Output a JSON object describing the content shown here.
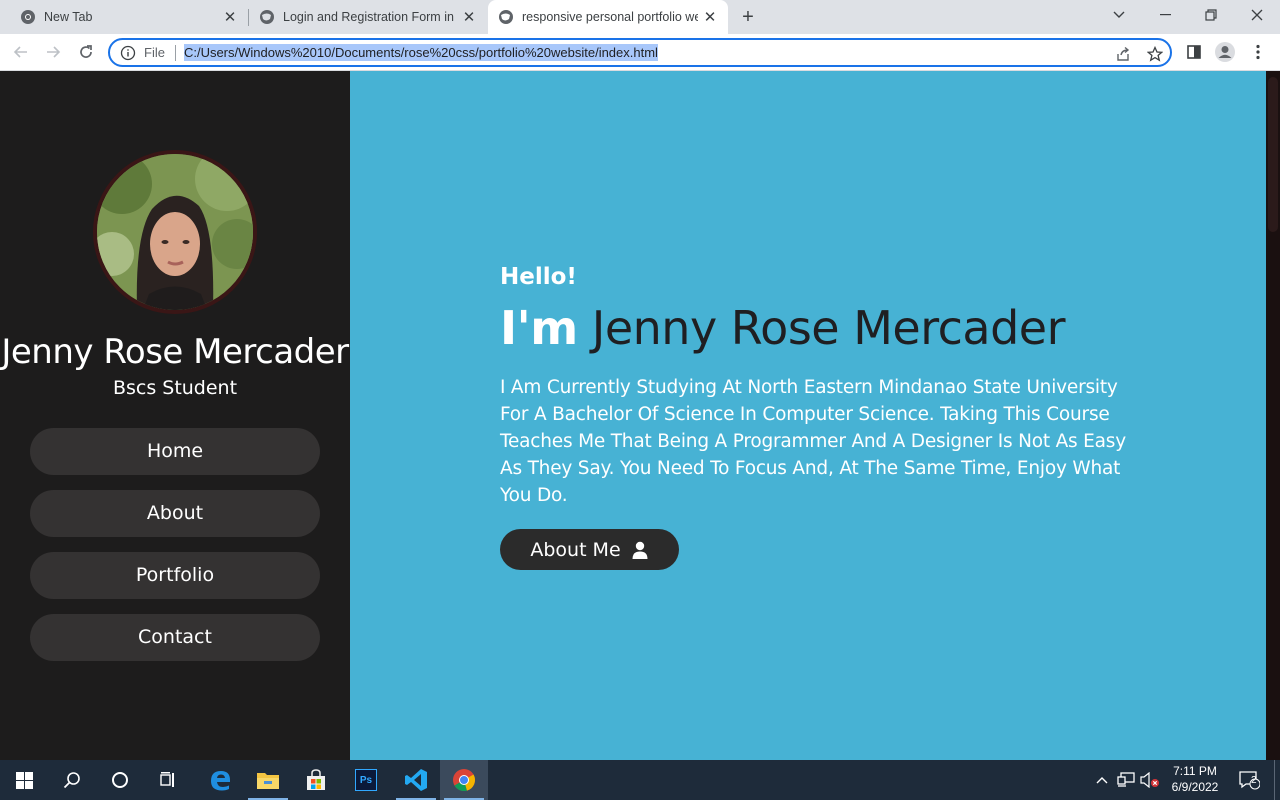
{
  "browser": {
    "tabs": [
      {
        "title": "New Tab",
        "active": false
      },
      {
        "title": "Login and Registration Form in H",
        "active": false
      },
      {
        "title": "responsive personal portfolio we",
        "active": true
      }
    ],
    "omnibox": {
      "scheme_label": "File",
      "url": "C:/Users/Windows%2010/Documents/rose%20css/portfolio%20website/index.html"
    },
    "icons": [
      "back-icon",
      "forward-icon",
      "reload-icon",
      "info-icon",
      "share-icon",
      "star-icon",
      "side-panel-icon",
      "profile-icon",
      "menu-icon"
    ]
  },
  "sidebar": {
    "name": "Jenny Rose Mercader",
    "role": "Bscs Student",
    "nav": [
      {
        "label": "Home"
      },
      {
        "label": "About"
      },
      {
        "label": "Portfolio"
      },
      {
        "label": "Contact"
      }
    ]
  },
  "hero": {
    "greeting": "Hello!",
    "im": "I'm",
    "name": "Jenny Rose Mercader",
    "bio": "I Am Currently Studying At North Eastern Mindanao State University For A Bachelor Of Science In Computer Science. Taking This Course Teaches Me That Being A Programmer And A Designer Is Not As Easy As They Say. You Need To Focus And, At The Same Time, Enjoy What You Do.",
    "button_label": "About Me"
  },
  "colors": {
    "sidebar_bg": "#1d1c1c",
    "main_bg": "#47b2d4",
    "nav_pill": "#343232",
    "button_bg": "#2b2b2b"
  },
  "taskbar": {
    "apps": [
      "windows-start-icon",
      "search-icon",
      "cortana-icon",
      "task-view-icon",
      "edge-icon",
      "file-explorer-icon",
      "store-icon",
      "photoshop-icon",
      "vscode-icon",
      "chrome-icon"
    ],
    "photoshop_label": "Ps",
    "time": "7:11 PM",
    "date": "6/9/2022",
    "notification_count": "2"
  }
}
